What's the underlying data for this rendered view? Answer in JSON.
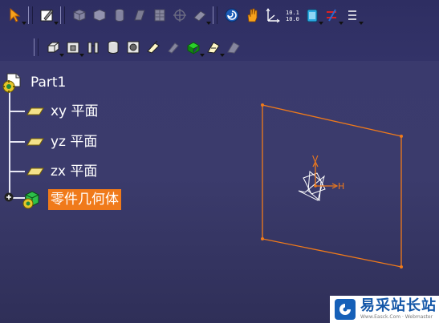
{
  "colors": {
    "background": "#3a3a6e",
    "selection": "#f07a1a",
    "plane_edge": "#f07a1a",
    "axis": "#ffffff",
    "watermark_brand": "#1457a8"
  },
  "toolbar": {
    "row1": [
      {
        "icon": "select-arrow-icon",
        "dropdown": true,
        "enabled": true
      },
      {
        "icon": "sketcher-icon",
        "dropdown": true,
        "enabled": true
      },
      {
        "icon": "isometric-view-icon",
        "dropdown": false,
        "enabled": false
      },
      {
        "icon": "front-view-icon",
        "dropdown": false,
        "enabled": false
      },
      {
        "icon": "cylinder-icon",
        "dropdown": false,
        "enabled": false
      },
      {
        "icon": "shaded-edges-icon",
        "dropdown": false,
        "enabled": false
      },
      {
        "icon": "multi-view-icon",
        "dropdown": false,
        "enabled": false
      },
      {
        "icon": "crosshair-icon",
        "dropdown": false,
        "enabled": false
      },
      {
        "icon": "eraser-icon",
        "dropdown": true,
        "enabled": false
      },
      {
        "icon": "fit-all-icon",
        "dropdown": false,
        "enabled": true
      },
      {
        "icon": "pan-hand-icon",
        "dropdown": false,
        "enabled": true
      },
      {
        "icon": "axis-system-icon",
        "dropdown": false,
        "enabled": true
      },
      {
        "icon": "measure-icon",
        "dropdown": false,
        "enabled": true
      },
      {
        "icon": "apply-material-icon",
        "dropdown": true,
        "enabled": true
      },
      {
        "icon": "constraint-icon",
        "dropdown": true,
        "enabled": true
      },
      {
        "icon": "more-tools-icon",
        "dropdown": true,
        "enabled": true
      }
    ],
    "row2": [
      {
        "icon": "pad-icon",
        "dropdown": true,
        "enabled": true
      },
      {
        "icon": "pocket-icon",
        "dropdown": true,
        "enabled": true
      },
      {
        "icon": "shaft-icon",
        "dropdown": false,
        "enabled": true
      },
      {
        "icon": "groove-icon",
        "dropdown": false,
        "enabled": true
      },
      {
        "icon": "hole-icon",
        "dropdown": false,
        "enabled": true
      },
      {
        "icon": "rib-icon",
        "dropdown": false,
        "enabled": true
      },
      {
        "icon": "slot-icon",
        "dropdown": false,
        "enabled": false
      },
      {
        "icon": "stiffener-icon",
        "dropdown": true,
        "enabled": true
      },
      {
        "icon": "multi-section-icon",
        "dropdown": true,
        "enabled": true
      },
      {
        "icon": "remove-section-icon",
        "dropdown": false,
        "enabled": false
      }
    ]
  },
  "tree": {
    "root": {
      "label": "Part1",
      "icon": "part-icon"
    },
    "children": [
      {
        "label": "xy 平面",
        "icon": "plane-icon"
      },
      {
        "label": "yz 平面",
        "icon": "plane-icon"
      },
      {
        "label": "zx 平面",
        "icon": "plane-icon"
      },
      {
        "label": "零件几何体",
        "icon": "body-icon",
        "selected": true,
        "expandable": true
      }
    ]
  },
  "viewport": {
    "axis_v_label": "V",
    "axis_h_label": "H"
  },
  "watermark": {
    "title": "易采站长站",
    "subtitle": "Www.Easck.Com · Webmaster"
  }
}
